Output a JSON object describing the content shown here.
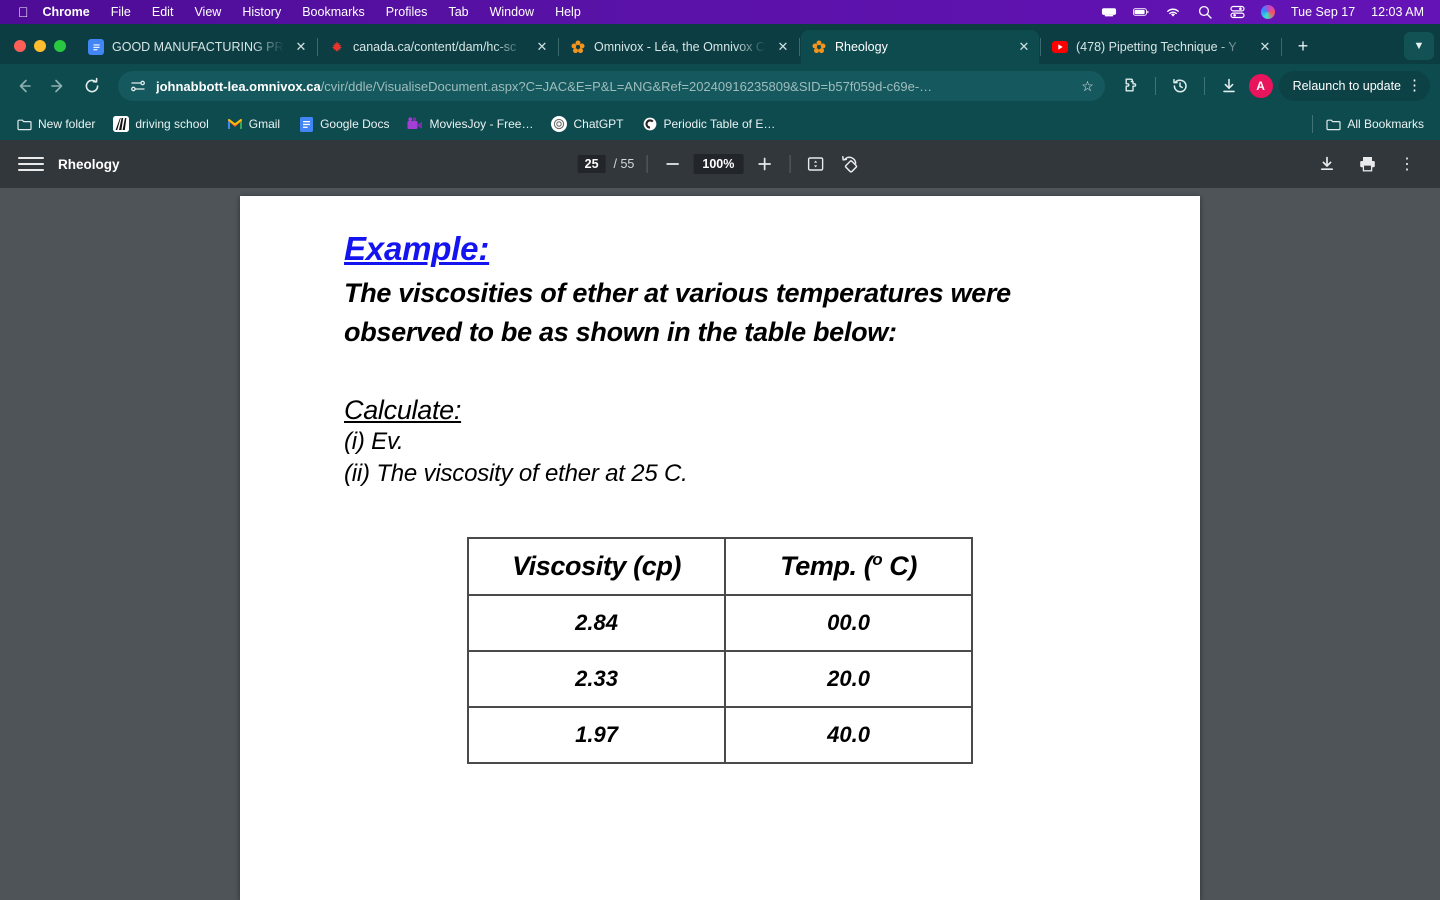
{
  "menubar": {
    "apple_icon": "apple-icon",
    "items": [
      {
        "label": "Chrome",
        "bold": true
      },
      {
        "label": "File",
        "bold": false
      },
      {
        "label": "Edit",
        "bold": false
      },
      {
        "label": "View",
        "bold": false
      },
      {
        "label": "History",
        "bold": false
      },
      {
        "label": "Bookmarks",
        "bold": false
      },
      {
        "label": "Profiles",
        "bold": false
      },
      {
        "label": "Tab",
        "bold": false
      },
      {
        "label": "Window",
        "bold": false
      },
      {
        "label": "Help",
        "bold": false
      }
    ],
    "status_icons": [
      "screen-mirroring-icon",
      "battery-icon",
      "wifi-icon",
      "search-icon",
      "control-center-icon",
      "siri-icon"
    ],
    "date": "Tue Sep 17",
    "time": "12:03 AM",
    "background_color": "#5a12a8"
  },
  "browser": {
    "tabs": [
      {
        "title": "GOOD MANUFACTURING PRA",
        "favicon": "google-docs-icon",
        "active": false
      },
      {
        "title": "canada.ca/content/dam/hc-sc",
        "favicon": "canada-maple-leaf-icon",
        "active": false
      },
      {
        "title": "Omnivox - Léa, the Omnivox C",
        "favicon": "omnivox-flower-icon",
        "active": false
      },
      {
        "title": "Rheology",
        "favicon": "omnivox-flower-icon",
        "active": true
      },
      {
        "title": "(478) Pipetting Technique - Y",
        "favicon": "youtube-icon",
        "active": false
      }
    ],
    "new_tab_label": "+",
    "tab_list_chevron": "chevron-down-icon",
    "toolbar": {
      "back_icon": "back-arrow-icon",
      "forward_icon": "forward-arrow-icon",
      "reload_icon": "reload-icon",
      "site_info_icon": "site-settings-icon",
      "url_domain": "johnabbott-lea.omnivox.ca",
      "url_path": "/cvir/ddle/VisualiseDocument.aspx?C=JAC&E=P&L=ANG&Ref=20240916235809&SID=b57f059d-c69e-…",
      "bookmark_icon": "star-icon",
      "extensions_icon": "puzzle-piece-icon",
      "history_icon": "history-clock-icon",
      "download_icon": "download-icon",
      "profile_initial": "A",
      "relaunch_label": "Relaunch to update",
      "menu_icon": "three-dot-menu-icon"
    },
    "bookmarks": [
      {
        "label": "New folder",
        "icon": "folder-icon"
      },
      {
        "label": "driving school",
        "icon": "driving-school-icon"
      },
      {
        "label": "Gmail",
        "icon": "gmail-icon"
      },
      {
        "label": "Google Docs",
        "icon": "google-docs-icon"
      },
      {
        "label": "MoviesJoy - Free…",
        "icon": "moviesjoy-icon"
      },
      {
        "label": "ChatGPT",
        "icon": "chatgpt-icon"
      },
      {
        "label": "Periodic Table of E…",
        "icon": "periodic-table-icon"
      }
    ],
    "all_bookmarks_label": "All Bookmarks",
    "all_bookmarks_icon": "folder-icon"
  },
  "pdf_viewer": {
    "menu_icon": "hamburger-menu-icon",
    "title": "Rheology",
    "current_page": "25",
    "total_pages": "/ 55",
    "zoom_out_icon": "minus-icon",
    "zoom_level": "100%",
    "zoom_in_icon": "plus-icon",
    "fit_page_icon": "fit-to-page-icon",
    "rotate_icon": "rotate-icon",
    "download_icon": "download-icon",
    "print_icon": "print-icon",
    "more_icon": "three-dot-menu-icon"
  },
  "document": {
    "heading": "Example:",
    "paragraph": "The viscosities of ether at various temperatures were observed to be as shown in the table below:",
    "subheading": "Calculate:",
    "items": [
      "(i) Ev.",
      "(ii) The viscosity of ether at 25 C."
    ],
    "table": {
      "headers": [
        "Viscosity (cp)",
        "Temp. ("
      ],
      "header_right_degree": "o",
      "header_right_suffix": " C)",
      "rows": [
        [
          "2.84",
          "00.0"
        ],
        [
          "2.33",
          "20.0"
        ],
        [
          "1.97",
          "40.0"
        ]
      ]
    }
  }
}
